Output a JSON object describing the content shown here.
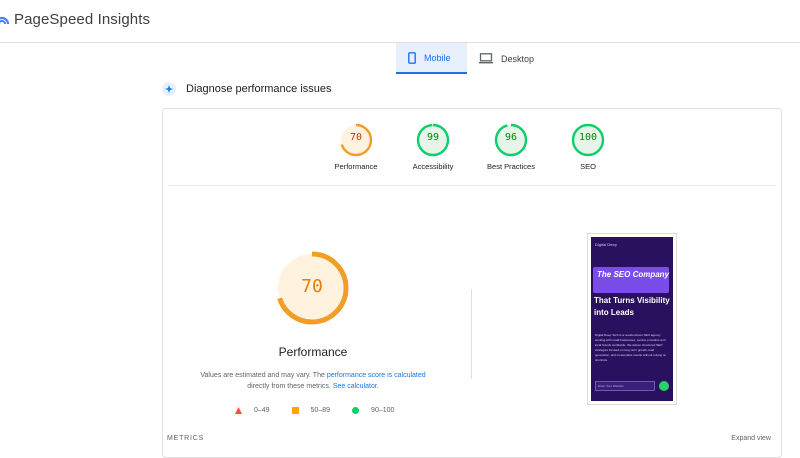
{
  "app": {
    "title": "PageSpeed Insights"
  },
  "tabs": [
    {
      "label": "Mobile",
      "icon": "mobile-icon",
      "active": true
    },
    {
      "label": "Desktop",
      "icon": "desktop-icon",
      "active": false
    }
  ],
  "section": {
    "title": "Diagnose performance issues",
    "icon": "diagnose-icon"
  },
  "scores": [
    {
      "value": "70",
      "label": "Performance",
      "color": "#f29e26",
      "bg": "#fff3e0",
      "fraction": 0.7,
      "text_color": "#c33300"
    },
    {
      "value": "99",
      "label": "Accessibility",
      "color": "#0cce6b",
      "bg": "#e6f4ea",
      "fraction": 0.99,
      "text_color": "#008800"
    },
    {
      "value": "96",
      "label": "Best Practices",
      "color": "#0cce6b",
      "bg": "#e6f4ea",
      "fraction": 0.96,
      "text_color": "#008800"
    },
    {
      "value": "100",
      "label": "SEO",
      "color": "#0cce6b",
      "bg": "#e6f4ea",
      "fraction": 1.0,
      "text_color": "#008800"
    }
  ],
  "main_score": {
    "value": "70",
    "label": "Performance",
    "fraction": 0.7,
    "color": "#f29e26",
    "bg": "#fff3e0"
  },
  "note": {
    "prefix": "Values are estimated and may vary. The ",
    "link1": "performance score is calculated",
    "middle": " directly from these metrics. ",
    "link2": "See calculator."
  },
  "legend": [
    {
      "range": "0–49",
      "shape": "triangle",
      "color": "#ff4e42"
    },
    {
      "range": "50–89",
      "shape": "square",
      "color": "#ffa400"
    },
    {
      "range": "90–100",
      "shape": "circle",
      "color": "#0cce6b"
    }
  ],
  "screenshot": {
    "logo": "Digital Deep",
    "badge": "The SEO Company",
    "headline": "That Turns Visibility into Leads",
    "body": "Digital Deep Tech is a results-driven SEO agency working with small businesses, service providers and local brands worldwide. We deliver structured SEO strategies focused on long-term growth, lead generation, and measurable results without relying on shortcuts.",
    "input_placeholder": "Enter Your Website"
  },
  "metrics": {
    "label": "METRICS",
    "expand": "Expand view"
  }
}
